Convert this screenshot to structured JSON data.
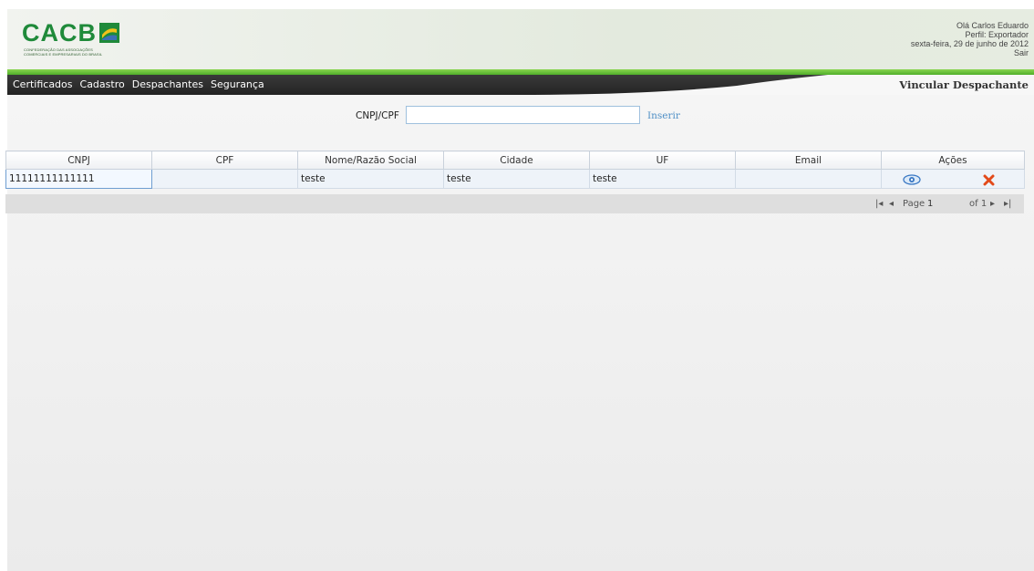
{
  "header": {
    "logo_text": "CACB",
    "logo_tagline": "CONFEDERAÇÃO DAS ASSOCIAÇÕES\nCOMERCIAIS E EMPRESARIAIS DO BRASIL",
    "greeting": "Olá Carlos Eduardo",
    "profile": "Perfil: Exportador",
    "date": "sexta-feira, 29 de junho de 2012",
    "logout": "Sair"
  },
  "nav": {
    "items": [
      {
        "label": "Certificados"
      },
      {
        "label": "Cadastro"
      },
      {
        "label": "Despachantes"
      },
      {
        "label": "Segurança"
      }
    ],
    "page_title": "Vincular Despachante"
  },
  "search": {
    "label": "CNPJ/CPF",
    "value": "",
    "insert_label": "Inserir"
  },
  "grid": {
    "columns": [
      "CNPJ",
      "CPF",
      "Nome/Razão Social",
      "Cidade",
      "UF",
      "Email",
      "Ações"
    ],
    "rows": [
      {
        "cnpj": "11111111111111",
        "cpf": "",
        "nome": "teste",
        "cidade": "teste",
        "uf": "teste",
        "email": ""
      }
    ]
  },
  "pager": {
    "page_label": "Page",
    "page_value": "1",
    "of_label": "of 1"
  },
  "colors": {
    "brand_green": "#1f8a3a",
    "nav_dark": "#2e2e2e",
    "link_blue": "#4f8fc6"
  }
}
